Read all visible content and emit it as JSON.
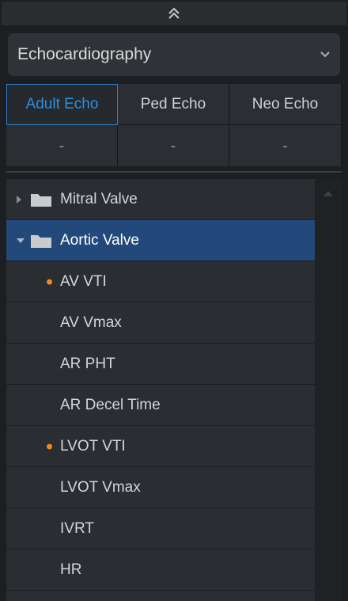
{
  "panel": {
    "collapse_icon": "double-chevron-up-icon"
  },
  "module_select": {
    "value": "Echocardiography",
    "icon": "chevron-down-icon"
  },
  "tabs": [
    {
      "label": "Adult Echo",
      "value": "-",
      "active": true
    },
    {
      "label": "Ped Echo",
      "value": "-",
      "active": false
    },
    {
      "label": "Neo Echo",
      "value": "-",
      "active": false
    }
  ],
  "tree": {
    "folders": [
      {
        "label": "Mitral Valve",
        "expanded": false,
        "selected": false
      },
      {
        "label": "Aortic Valve",
        "expanded": true,
        "selected": true
      }
    ],
    "items": [
      {
        "label": "AV VTI",
        "marked": true
      },
      {
        "label": "AV Vmax",
        "marked": false
      },
      {
        "label": "AR PHT",
        "marked": false
      },
      {
        "label": "AR Decel Time",
        "marked": false
      },
      {
        "label": "LVOT VTI",
        "marked": true
      },
      {
        "label": "LVOT Vmax",
        "marked": false
      },
      {
        "label": "IVRT",
        "marked": false
      },
      {
        "label": "HR",
        "marked": false
      }
    ]
  },
  "colors": {
    "accent": "#2d8ee6",
    "selected_row": "#23497a",
    "marker": "#f08a1d"
  }
}
